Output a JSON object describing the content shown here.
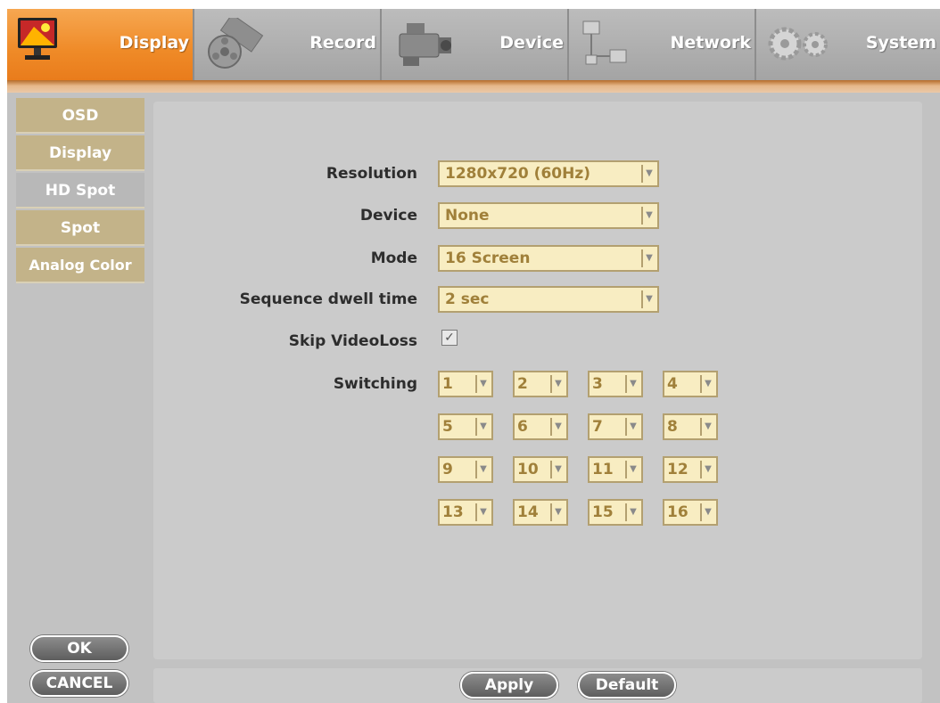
{
  "nav": {
    "tabs": [
      {
        "label": "Display",
        "icon": "monitor-icon",
        "active": true
      },
      {
        "label": "Record",
        "icon": "film-reel-icon",
        "active": false
      },
      {
        "label": "Device",
        "icon": "camera-icon",
        "active": false
      },
      {
        "label": "Network",
        "icon": "network-icon",
        "active": false
      },
      {
        "label": "System",
        "icon": "gears-icon",
        "active": false
      }
    ]
  },
  "sidebar": {
    "items": [
      {
        "label": "OSD",
        "active": false
      },
      {
        "label": "Display",
        "active": false
      },
      {
        "label": "HD Spot",
        "active": true
      },
      {
        "label": "Spot",
        "active": false
      },
      {
        "label": "Analog Color",
        "active": false
      }
    ],
    "ok_label": "OK",
    "cancel_label": "CANCEL"
  },
  "form": {
    "resolution": {
      "label": "Resolution",
      "value": "1280x720 (60Hz)"
    },
    "device": {
      "label": "Device",
      "value": "None"
    },
    "mode": {
      "label": "Mode",
      "value": "16 Screen"
    },
    "dwell": {
      "label": "Sequence dwell time",
      "value": "2 sec"
    },
    "skip_videoloss": {
      "label": "Skip VideoLoss",
      "checked": true
    },
    "switching": {
      "label": "Switching",
      "values": [
        "1",
        "2",
        "3",
        "4",
        "5",
        "6",
        "7",
        "8",
        "9",
        "10",
        "11",
        "12",
        "13",
        "14",
        "15",
        "16"
      ]
    }
  },
  "footer": {
    "apply_label": "Apply",
    "default_label": "Default"
  },
  "colors": {
    "accent_orange": "#ef8a27",
    "field_bg": "#f8edc2",
    "field_border": "#b3a070",
    "sidebar_gold": "#c3b389"
  }
}
